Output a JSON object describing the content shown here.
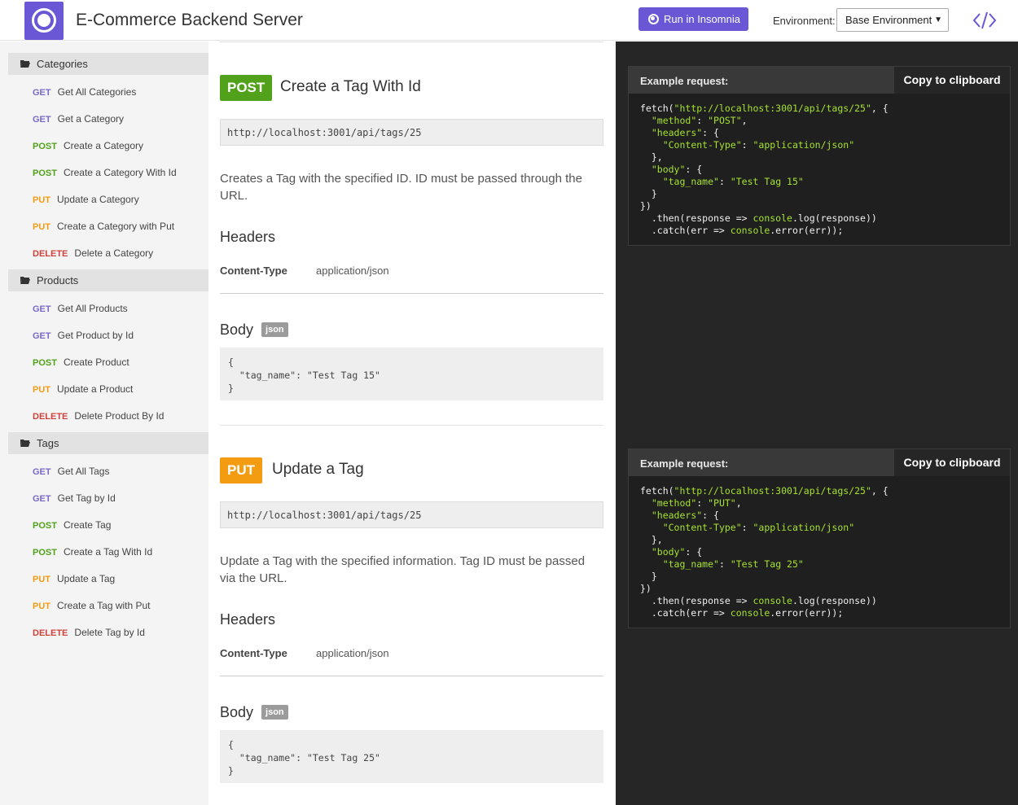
{
  "header": {
    "title": "E-Commerce Backend Server",
    "run_label": "Run in Insomnia",
    "env_label": "Environment:",
    "env_value": "Base Environment"
  },
  "sidebar": {
    "groups": [
      {
        "label": "Categories",
        "items": [
          {
            "method": "GET",
            "label": "Get All Categories"
          },
          {
            "method": "GET",
            "label": "Get a Category"
          },
          {
            "method": "POST",
            "label": "Create a Category"
          },
          {
            "method": "POST",
            "label": "Create a Category With Id"
          },
          {
            "method": "PUT",
            "label": "Update a Category"
          },
          {
            "method": "PUT",
            "label": "Create a Category with Put"
          },
          {
            "method": "DELETE",
            "label": "Delete a Category"
          }
        ]
      },
      {
        "label": "Products",
        "items": [
          {
            "method": "GET",
            "label": "Get All Products"
          },
          {
            "method": "GET",
            "label": "Get Product by Id"
          },
          {
            "method": "POST",
            "label": "Create Product"
          },
          {
            "method": "PUT",
            "label": "Update a Product"
          },
          {
            "method": "DELETE",
            "label": "Delete Product By Id"
          }
        ]
      },
      {
        "label": "Tags",
        "items": [
          {
            "method": "GET",
            "label": "Get All Tags"
          },
          {
            "method": "GET",
            "label": "Get Tag by Id"
          },
          {
            "method": "POST",
            "label": "Create Tag"
          },
          {
            "method": "POST",
            "label": "Create a Tag With Id"
          },
          {
            "method": "PUT",
            "label": "Update a Tag"
          },
          {
            "method": "PUT",
            "label": "Create a Tag with Put"
          },
          {
            "method": "DELETE",
            "label": "Delete Tag by Id"
          }
        ]
      }
    ]
  },
  "endpoints": [
    {
      "method": "POST",
      "title": "Create a Tag With Id",
      "url": "http://localhost:3001/api/tags/25",
      "description": "Creates a Tag with the specified ID. ID must be passed through the URL.",
      "headers_title": "Headers",
      "header_key": "Content-Type",
      "header_value": "application/json",
      "body_title": "Body",
      "body_badge": "json",
      "body": "{\n  \"tag_name\": \"Test Tag 15\"\n}",
      "example_label": "Example request:",
      "copy_label": "Copy to clipboard",
      "code": {
        "url": "\"http://localhost:3001/api/tags/25\"",
        "method_value": "\"POST\"",
        "tag_name_value": "\"Test Tag 15\""
      }
    },
    {
      "method": "PUT",
      "title": "Update a Tag",
      "url": "http://localhost:3001/api/tags/25",
      "description": "Update a Tag with the specified information. Tag ID must be passed via the URL.",
      "headers_title": "Headers",
      "header_key": "Content-Type",
      "header_value": "application/json",
      "body_title": "Body",
      "body_badge": "json",
      "body": "{\n  \"tag_name\": \"Test Tag 25\"\n}",
      "example_label": "Example request:",
      "copy_label": "Copy to clipboard",
      "code": {
        "url": "\"http://localhost:3001/api/tags/25\"",
        "method_value": "\"PUT\"",
        "tag_name_value": "\"Test Tag 25\""
      }
    }
  ],
  "colors": {
    "brand": "#6a57d5",
    "get": "#7a69c7",
    "post": "#51a11a",
    "put": "#f39c12",
    "delete": "#d0423d",
    "code_string": "#a6e22e"
  }
}
